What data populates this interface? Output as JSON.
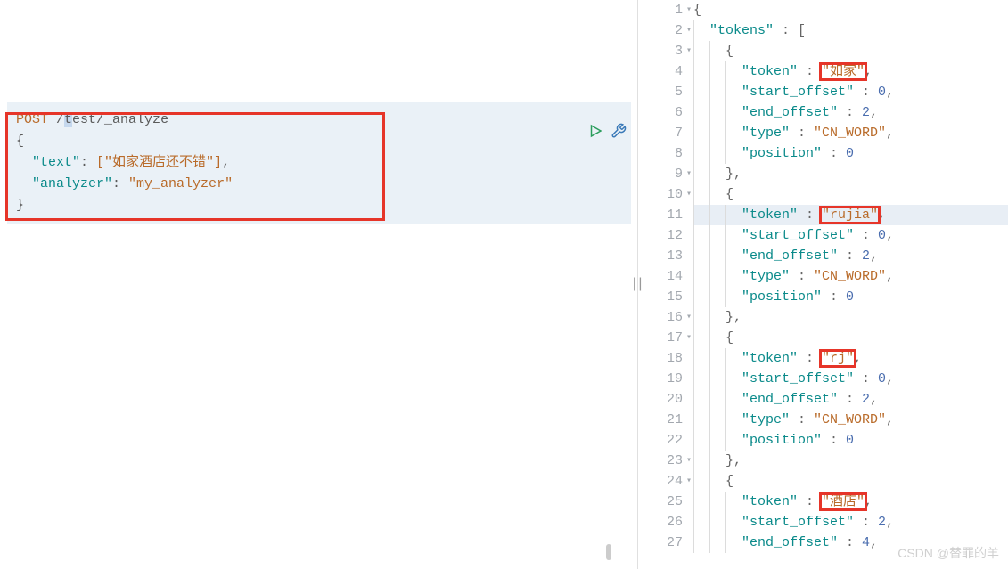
{
  "request": {
    "method": "POST",
    "path_prefix": " /",
    "path_selected": "t",
    "path_suffix": "est/_analyze",
    "body_lines": {
      "open": "{",
      "text_key": "\"text\"",
      "text_val": "[\"如家酒店还不错\"]",
      "analyzer_key": "\"analyzer\"",
      "analyzer_val": "\"my_analyzer\"",
      "close": "}"
    }
  },
  "response": {
    "lines": [
      {
        "num": "1",
        "fold": true,
        "content": [
          {
            "t": "jpunct",
            "v": "{"
          }
        ]
      },
      {
        "num": "2",
        "fold": true,
        "indent": 1,
        "content": [
          {
            "t": "jkey",
            "v": "\"tokens\""
          },
          {
            "t": "jpunct",
            "v": " : ["
          }
        ]
      },
      {
        "num": "3",
        "fold": true,
        "indent": 2,
        "content": [
          {
            "t": "jpunct",
            "v": "{"
          }
        ]
      },
      {
        "num": "4",
        "indent": 3,
        "content": [
          {
            "t": "jkey",
            "v": "\"token\""
          },
          {
            "t": "jpunct",
            "v": " : "
          },
          {
            "t": "jstr",
            "v": "\"如家\"",
            "box": true
          },
          {
            "t": "jpunct",
            "v": ","
          }
        ]
      },
      {
        "num": "5",
        "indent": 3,
        "content": [
          {
            "t": "jkey",
            "v": "\"start_offset\""
          },
          {
            "t": "jpunct",
            "v": " : "
          },
          {
            "t": "jnum",
            "v": "0"
          },
          {
            "t": "jpunct",
            "v": ","
          }
        ]
      },
      {
        "num": "6",
        "indent": 3,
        "content": [
          {
            "t": "jkey",
            "v": "\"end_offset\""
          },
          {
            "t": "jpunct",
            "v": " : "
          },
          {
            "t": "jnum",
            "v": "2"
          },
          {
            "t": "jpunct",
            "v": ","
          }
        ]
      },
      {
        "num": "7",
        "indent": 3,
        "content": [
          {
            "t": "jkey",
            "v": "\"type\""
          },
          {
            "t": "jpunct",
            "v": " : "
          },
          {
            "t": "jstr",
            "v": "\"CN_WORD\""
          },
          {
            "t": "jpunct",
            "v": ","
          }
        ]
      },
      {
        "num": "8",
        "indent": 3,
        "content": [
          {
            "t": "jkey",
            "v": "\"position\""
          },
          {
            "t": "jpunct",
            "v": " : "
          },
          {
            "t": "jnum",
            "v": "0"
          }
        ]
      },
      {
        "num": "9",
        "fold": true,
        "indent": 2,
        "content": [
          {
            "t": "jpunct",
            "v": "},"
          }
        ]
      },
      {
        "num": "10",
        "fold": true,
        "indent": 2,
        "content": [
          {
            "t": "jpunct",
            "v": "{"
          }
        ]
      },
      {
        "num": "11",
        "hl": true,
        "indent": 3,
        "content": [
          {
            "t": "jkey",
            "v": "\"token\""
          },
          {
            "t": "jpunct",
            "v": " : "
          },
          {
            "t": "jstr",
            "v": "\"rujia\"",
            "box": true
          },
          {
            "t": "jpunct",
            "v": ","
          }
        ]
      },
      {
        "num": "12",
        "indent": 3,
        "content": [
          {
            "t": "jkey",
            "v": "\"start_offset\""
          },
          {
            "t": "jpunct",
            "v": " : "
          },
          {
            "t": "jnum",
            "v": "0"
          },
          {
            "t": "jpunct",
            "v": ","
          }
        ]
      },
      {
        "num": "13",
        "indent": 3,
        "content": [
          {
            "t": "jkey",
            "v": "\"end_offset\""
          },
          {
            "t": "jpunct",
            "v": " : "
          },
          {
            "t": "jnum",
            "v": "2"
          },
          {
            "t": "jpunct",
            "v": ","
          }
        ]
      },
      {
        "num": "14",
        "indent": 3,
        "content": [
          {
            "t": "jkey",
            "v": "\"type\""
          },
          {
            "t": "jpunct",
            "v": " : "
          },
          {
            "t": "jstr",
            "v": "\"CN_WORD\""
          },
          {
            "t": "jpunct",
            "v": ","
          }
        ]
      },
      {
        "num": "15",
        "indent": 3,
        "content": [
          {
            "t": "jkey",
            "v": "\"position\""
          },
          {
            "t": "jpunct",
            "v": " : "
          },
          {
            "t": "jnum",
            "v": "0"
          }
        ]
      },
      {
        "num": "16",
        "fold": true,
        "indent": 2,
        "content": [
          {
            "t": "jpunct",
            "v": "},"
          }
        ]
      },
      {
        "num": "17",
        "fold": true,
        "indent": 2,
        "content": [
          {
            "t": "jpunct",
            "v": "{"
          }
        ]
      },
      {
        "num": "18",
        "indent": 3,
        "content": [
          {
            "t": "jkey",
            "v": "\"token\""
          },
          {
            "t": "jpunct",
            "v": " : "
          },
          {
            "t": "jstr",
            "v": "\"rj\"",
            "box": true
          },
          {
            "t": "jpunct",
            "v": ","
          }
        ]
      },
      {
        "num": "19",
        "indent": 3,
        "content": [
          {
            "t": "jkey",
            "v": "\"start_offset\""
          },
          {
            "t": "jpunct",
            "v": " : "
          },
          {
            "t": "jnum",
            "v": "0"
          },
          {
            "t": "jpunct",
            "v": ","
          }
        ],
        "cursor": true
      },
      {
        "num": "20",
        "indent": 3,
        "content": [
          {
            "t": "jkey",
            "v": "\"end_offset\""
          },
          {
            "t": "jpunct",
            "v": " : "
          },
          {
            "t": "jnum",
            "v": "2"
          },
          {
            "t": "jpunct",
            "v": ","
          }
        ]
      },
      {
        "num": "21",
        "indent": 3,
        "content": [
          {
            "t": "jkey",
            "v": "\"type\""
          },
          {
            "t": "jpunct",
            "v": " : "
          },
          {
            "t": "jstr",
            "v": "\"CN_WORD\""
          },
          {
            "t": "jpunct",
            "v": ","
          }
        ]
      },
      {
        "num": "22",
        "indent": 3,
        "content": [
          {
            "t": "jkey",
            "v": "\"position\""
          },
          {
            "t": "jpunct",
            "v": " : "
          },
          {
            "t": "jnum",
            "v": "0"
          }
        ]
      },
      {
        "num": "23",
        "fold": true,
        "indent": 2,
        "content": [
          {
            "t": "jpunct",
            "v": "},"
          }
        ]
      },
      {
        "num": "24",
        "fold": true,
        "indent": 2,
        "content": [
          {
            "t": "jpunct",
            "v": "{"
          }
        ]
      },
      {
        "num": "25",
        "indent": 3,
        "content": [
          {
            "t": "jkey",
            "v": "\"token\""
          },
          {
            "t": "jpunct",
            "v": " : "
          },
          {
            "t": "jstr",
            "v": "\"酒店\"",
            "box": true
          },
          {
            "t": "jpunct",
            "v": ","
          }
        ]
      },
      {
        "num": "26",
        "indent": 3,
        "content": [
          {
            "t": "jkey",
            "v": "\"start_offset\""
          },
          {
            "t": "jpunct",
            "v": " : "
          },
          {
            "t": "jnum",
            "v": "2"
          },
          {
            "t": "jpunct",
            "v": ","
          }
        ]
      },
      {
        "num": "27",
        "indent": 3,
        "content": [
          {
            "t": "jkey",
            "v": "\"end_offset\""
          },
          {
            "t": "jpunct",
            "v": " : "
          },
          {
            "t": "jnum",
            "v": "4"
          },
          {
            "t": "jpunct",
            "v": ","
          }
        ]
      }
    ]
  },
  "watermark": "CSDN @替罪的羊"
}
